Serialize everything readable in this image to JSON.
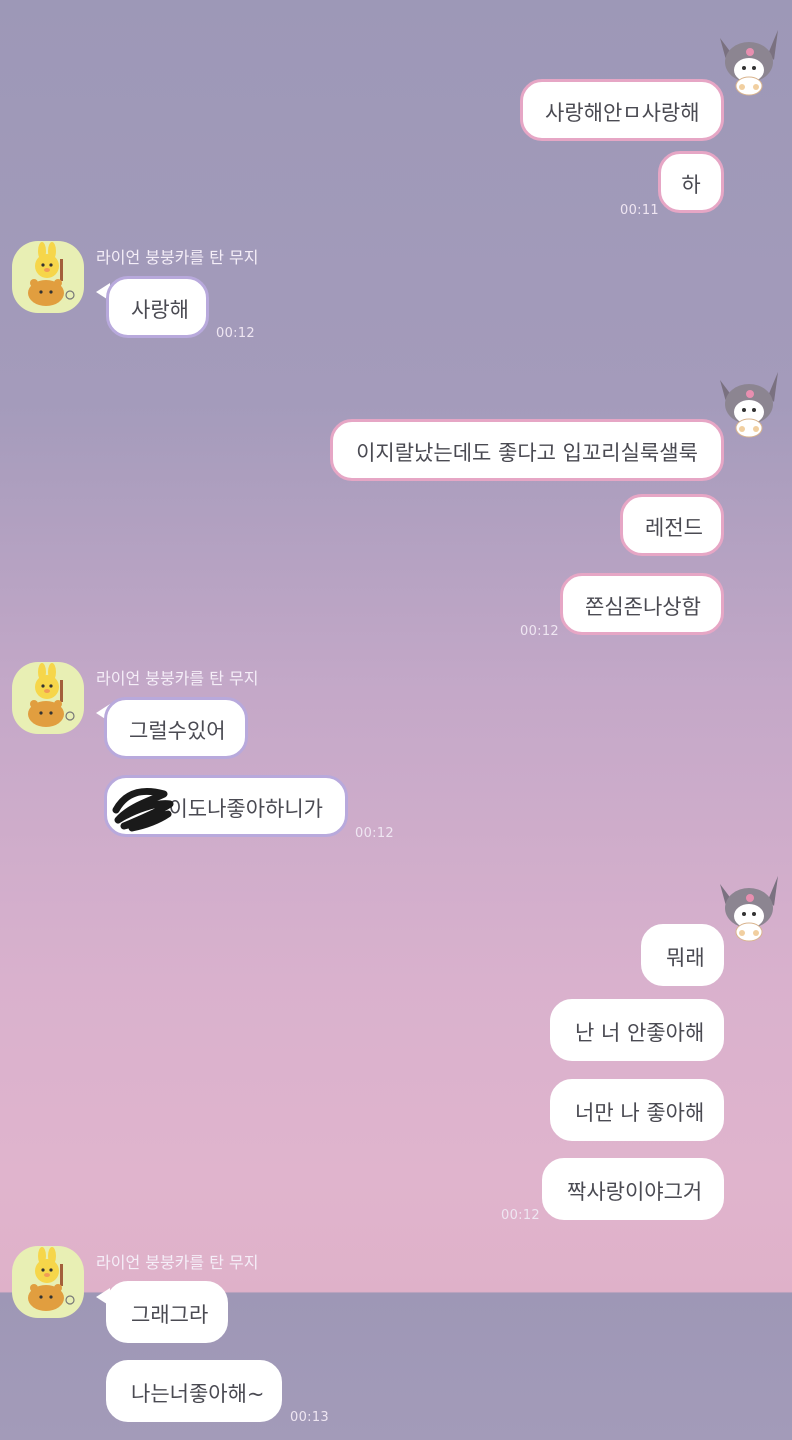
{
  "chat": {
    "friend_name": "라이언 붕붕카를 탄 무지",
    "groups": [
      {
        "messages": [
          "사랑해안ㅁ사랑해",
          "하"
        ],
        "time": "00:11"
      },
      {
        "messages": [
          "사랑해"
        ],
        "time": "00:12"
      },
      {
        "messages": [
          "이지랄났는데도 좋다고 입꼬리실룩샐룩",
          "레전드",
          "쫀심존나상함"
        ],
        "time": "00:12"
      },
      {
        "messages": [
          "그럴수있어",
          "이도나좋아하니가"
        ],
        "time": "00:12"
      },
      {
        "messages": [
          "뭐래",
          "난 너 안좋아해",
          "너만 나 좋아해",
          "짝사랑이야그거"
        ],
        "time": "00:12"
      },
      {
        "messages": [
          "그래그라",
          "나는너좋아해~"
        ],
        "time": "00:13"
      }
    ]
  },
  "avatars": {
    "friend_icon": "ryan-riding-muzi-avatar-icon",
    "me_icon": "kuromi-avatar-icon"
  },
  "colors": {
    "top_bg": "#9d98b7",
    "bottom_bg": "#e0b4cd",
    "my_bubble_border": "#e6a6c5",
    "their_bubble_border": "#b8a9dc",
    "bubble_fill": "#ffffff",
    "avatar_bg": "#e8efb4"
  }
}
